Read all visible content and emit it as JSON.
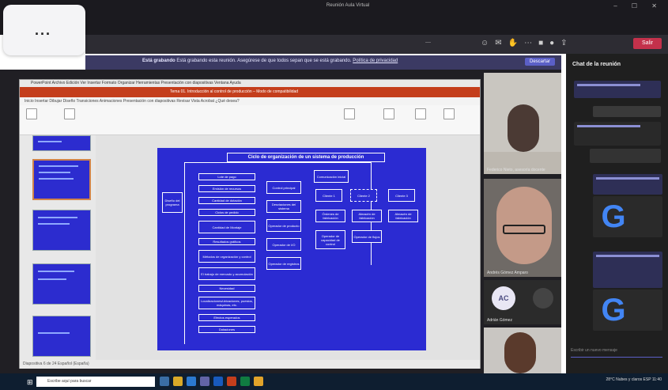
{
  "popup": {
    "label": "..."
  },
  "teams": {
    "window_title": "Reunión Aula Virtual",
    "window_controls": "– ☐ ✕",
    "timer": "—",
    "leave_label": "Salir",
    "notification": {
      "bold_label": "Está grabando",
      "text": "Está grabando esta reunión. Asegúrese de que todos sepan que se está grabando.",
      "link": "Política de privacidad",
      "dismiss_label": "Descartar"
    }
  },
  "ppt": {
    "menu_items": "PowerPoint  Archivo  Edición  Ver  Insertar  Formato  Organizar  Herramientas  Presentación con diapositivas  Ventana  Ayuda",
    "title": "Tema 01. Introducción al control de producción – Modo de compatibilidad",
    "tabs": "Inicio   Insertar   Dibujar   Diseño   Transiciones   Animaciones   Presentación con diapositivas   Revisar   Vista   Acrobat   ¿Qué desea?",
    "status": "Diapositiva 6 de 24   Español (España)",
    "slide_numbers": [
      "",
      "",
      "",
      "",
      ""
    ]
  },
  "slide": {
    "title": "Ciclo de organización de un sistema de producción",
    "left_box": "Diseño del programa",
    "col1": [
      "Lote de pago",
      "Emisión de recursos",
      "Cantidad de dotación",
      "Ciclos de pedido",
      "Cantidad de Montaje",
      "Resultados gráficos",
      "Métodos de organización y control",
      "El trabajo de mercado y acumulación",
      "Necesidad",
      "Localizaciones/ubicaciones, puestos, máquinas, etc.",
      "Efectos esperados",
      "Dotaciones"
    ],
    "col2": [
      "Control principal",
      "Desviaciones del sistema",
      "Operador de producto",
      "Operador de I/O",
      "Operador de registros"
    ],
    "col3_top": "Comunicación inicial",
    "col3_mid": [
      "Cliente 1",
      "Cliente 2",
      "Cliente 3"
    ],
    "col3_row3": [
      "Órdenes de fabricación",
      "Almacén de fabricación",
      "Almacén de fabricación"
    ],
    "col3_row4": [
      "Operador de capacidad de control",
      "Operador de flujos"
    ]
  },
  "videos": {
    "p1_name": "Federico Nieto, asesoría docente",
    "p2_name": "Andrés Gómez Amparo",
    "p3_initials": "AC",
    "p3_name": "Adrián Gómez"
  },
  "chat": {
    "title": "Chat de la reunión",
    "input_placeholder": "Escribir un nuevo mensaje",
    "google_letter": "G"
  },
  "taskbar": {
    "search_placeholder": "Escribe aquí para buscar",
    "tray": "28°C Nubes y claros   ESP   11:40"
  },
  "colors": {
    "slide_bg": "#2b2bd2",
    "ppt_accent": "#c43e1c",
    "teams_accent": "#5b5fc7",
    "leave": "#c4314b"
  }
}
